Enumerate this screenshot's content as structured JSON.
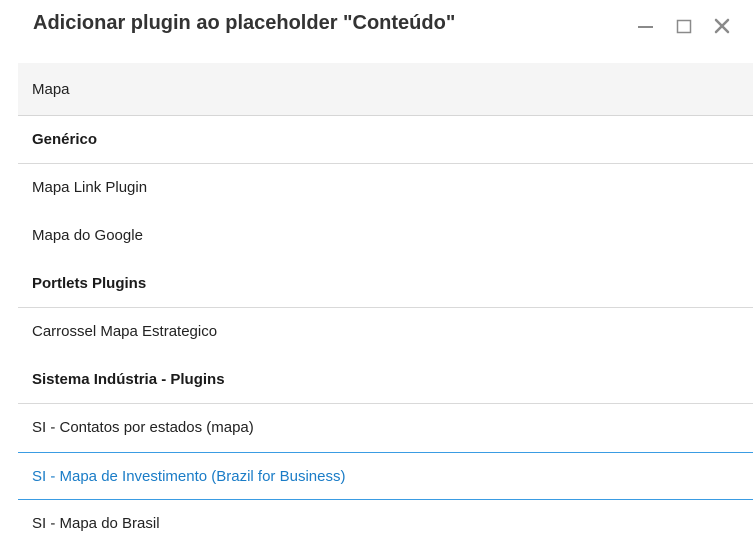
{
  "dialog": {
    "title": "Adicionar plugin ao placeholder \"Conteúdo\"",
    "controls": {
      "minimize": "minimize-icon",
      "maximize": "maximize-icon",
      "close": "close-icon"
    }
  },
  "search": {
    "value": "Mapa",
    "placeholder": ""
  },
  "list": {
    "groups": [
      {
        "header": "Genérico",
        "items": [
          "Mapa Link Plugin",
          "Mapa do Google"
        ]
      },
      {
        "header": "Portlets Plugins",
        "items": [
          "Carrossel Mapa Estrategico"
        ]
      },
      {
        "header": "Sistema Indústria - Plugins",
        "items": [
          "SI - Contatos por estados (mapa)",
          "SI - Mapa de Investimento (Brazil for Business)",
          "SI - Mapa do Brasil"
        ]
      }
    ],
    "selected_item": "SI - Mapa de Investimento (Brazil for Business)"
  },
  "colors": {
    "selected_text": "#1a7cc7",
    "selected_border": "#3a9ce3",
    "search_background": "#f5f5f5"
  }
}
